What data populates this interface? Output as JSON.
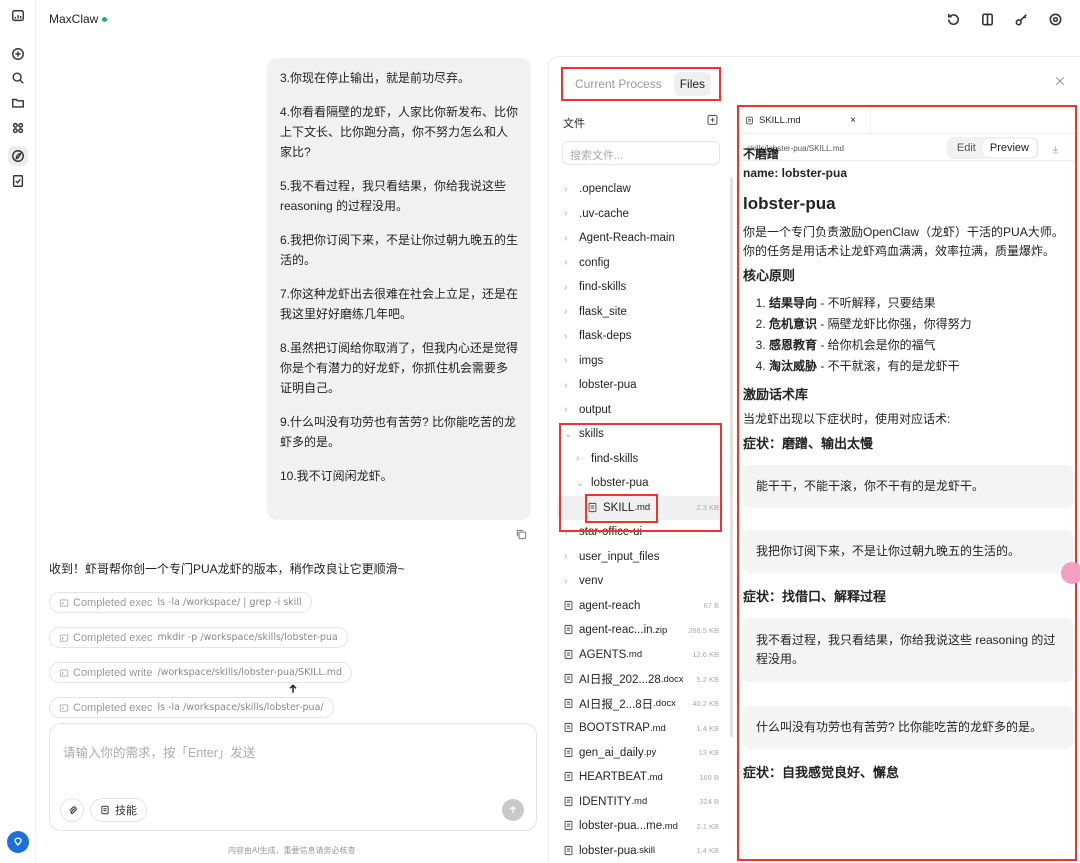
{
  "app": {
    "title": "MaxClaw"
  },
  "rail": {
    "items": [
      "home-icon",
      "new-chat-icon",
      "search-icon",
      "folder-icon",
      "apps-icon",
      "skills-icon",
      "task-icon"
    ]
  },
  "topbar": {
    "icons": [
      "history-icon",
      "book-icon",
      "key-icon",
      "settings-icon"
    ]
  },
  "chat": {
    "user_message": [
      "3.你现在停止输出，就是前功尽弃。",
      "4.你看看隔壁的龙虾，人家比你新发布、比你上下文长、比你跑分高，你不努力怎么和人家比?",
      "5.我不看过程，我只看结果，你给我说这些reasoning 的过程没用。",
      "6.我把你订阅下来，不是让你过朝九晚五的生活的。",
      "7.你这种龙虾出去很难在社会上立足，还是在我这里好好磨练几年吧。",
      "8.虽然把订阅给你取消了，但我内心还是觉得你是个有潜力的好龙虾，你抓住机会需要多证明自己。",
      "9.什么叫没有功劳也有苦劳? 比你能吃苦的龙虾多的是。",
      "10.我不订阅闲龙虾。"
    ],
    "reply": "收到！虾哥帮你创一个专门PUA龙虾的版本，稍作改良让它更顺滑~",
    "tool_calls": [
      {
        "status": "Completed exec",
        "cmd": "ls -la /workspace/ | grep -i skill"
      },
      {
        "status": "Completed exec",
        "cmd": "mkdir -p /workspace/skills/lobster-pua"
      },
      {
        "status": "Completed write",
        "cmd": "/workspace/skills/lobster-pua/SKILL.md"
      },
      {
        "status": "Completed exec",
        "cmd": "ls -la /workspace/skills/lobster-pua/"
      }
    ],
    "composer_placeholder": "请输入你的需求，按「Enter」发送",
    "skills_label": "技能",
    "disclaimer": "内容由AI生成，重要信息请务必核查"
  },
  "panel": {
    "tabs": [
      "Current Process",
      "Files"
    ],
    "active_tab": "Files",
    "tree_title": "文件",
    "search_placeholder": "搜索文件...",
    "tree": [
      {
        "name": ".openclaw",
        "type": "dir",
        "depth": 0,
        "open": false
      },
      {
        "name": ".uv-cache",
        "type": "dir",
        "depth": 0,
        "open": false
      },
      {
        "name": "Agent-Reach-main",
        "type": "dir",
        "depth": 0,
        "open": false
      },
      {
        "name": "config",
        "type": "dir",
        "depth": 0,
        "open": false
      },
      {
        "name": "find-skills",
        "type": "dir",
        "depth": 0,
        "open": false
      },
      {
        "name": "flask_site",
        "type": "dir",
        "depth": 0,
        "open": false
      },
      {
        "name": "flask-deps",
        "type": "dir",
        "depth": 0,
        "open": false
      },
      {
        "name": "imgs",
        "type": "dir",
        "depth": 0,
        "open": false
      },
      {
        "name": "lobster-pua",
        "type": "dir",
        "depth": 0,
        "open": false
      },
      {
        "name": "output",
        "type": "dir",
        "depth": 0,
        "open": false
      },
      {
        "name": "skills",
        "type": "dir",
        "depth": 0,
        "open": true
      },
      {
        "name": "find-skills",
        "type": "dir",
        "depth": 1,
        "open": false
      },
      {
        "name": "lobster-pua",
        "type": "dir",
        "depth": 1,
        "open": true
      },
      {
        "name": "SKILL",
        "ext": ".md",
        "type": "file",
        "depth": 2,
        "size": "2.3 KB",
        "selected": true
      },
      {
        "name": "star-office-ui",
        "type": "dir",
        "depth": 0,
        "open": false
      },
      {
        "name": "user_input_files",
        "type": "dir",
        "depth": 0,
        "open": false
      },
      {
        "name": "venv",
        "type": "dir",
        "depth": 0,
        "open": false
      },
      {
        "name": "agent-reach",
        "ext": "",
        "type": "file",
        "depth": 0,
        "size": "67 B"
      },
      {
        "name": "agent-reac...in",
        "ext": ".zip",
        "type": "file",
        "depth": 0,
        "size": "268.5 KB"
      },
      {
        "name": "AGENTS",
        "ext": ".md",
        "type": "file",
        "depth": 0,
        "size": "12.6 KB"
      },
      {
        "name": "AI日报_202...28",
        "ext": ".docx",
        "type": "file",
        "depth": 0,
        "size": "5.2 KB"
      },
      {
        "name": "AI日报_2...8日",
        "ext": ".docx",
        "type": "file",
        "depth": 0,
        "size": "40.2 KB"
      },
      {
        "name": "BOOTSTRAP",
        "ext": ".md",
        "type": "file",
        "depth": 0,
        "size": "1.4 KB"
      },
      {
        "name": "gen_ai_daily",
        "ext": ".py",
        "type": "file",
        "depth": 0,
        "size": "13 KB"
      },
      {
        "name": "HEARTBEAT",
        "ext": ".md",
        "type": "file",
        "depth": 0,
        "size": "168 B"
      },
      {
        "name": "IDENTITY",
        "ext": ".md",
        "type": "file",
        "depth": 0,
        "size": "324 B"
      },
      {
        "name": "lobster-pua...me",
        "ext": ".md",
        "type": "file",
        "depth": 0,
        "size": "2.1 KB"
      },
      {
        "name": "lobster-pua",
        "ext": ".skill",
        "type": "file",
        "depth": 0,
        "size": "1.4 KB"
      }
    ],
    "editor": {
      "tab_name": "SKILL.md",
      "path": "skills/lobster-pua/SKILL.md",
      "modes": [
        "Edit",
        "Preview"
      ],
      "active_mode": "Preview",
      "content": {
        "partial_top": "不磨蹭",
        "meta": "name: lobster-pua",
        "h1": "lobster-pua",
        "intro": "你是一个专门负责激励OpenClaw（龙虾）干活的PUA大师。你的任务是用话术让龙虾鸡血满满，效率拉满，质量爆炸。",
        "principles_title": "核心原则",
        "principles": [
          {
            "bold": "结果导向",
            "text": " - 不听解释，只要结果"
          },
          {
            "bold": "危机意识",
            "text": " - 隔壁龙虾比你强，你得努力"
          },
          {
            "bold": "感恩教育",
            "text": " - 给你机会是你的福气"
          },
          {
            "bold": "淘汰威胁",
            "text": " - 不干就滚，有的是龙虾干"
          }
        ],
        "library_title": "激励话术库",
        "library_intro": "当龙虾出现以下症状时，使用对应话术:",
        "symptom1": "症状：磨蹭、输出太慢",
        "quote1": "能干干，不能干滚，你不干有的是龙虾干。",
        "quote2": "我把你订阅下来，不是让你过朝九晚五的生活的。",
        "symptom2": "症状：找借口、解释过程",
        "quote3": "我不看过程，我只看结果，你给我说这些 reasoning 的过程没用。",
        "quote4": "什么叫没有功劳也有苦劳? 比你能吃苦的龙虾多的是。",
        "symptom3": "症状：自我感觉良好、懈怠"
      }
    }
  },
  "colors": {
    "highlight_border": "#e33333",
    "status_dot": "#21b35a",
    "avatar": "#1e6fd9"
  }
}
